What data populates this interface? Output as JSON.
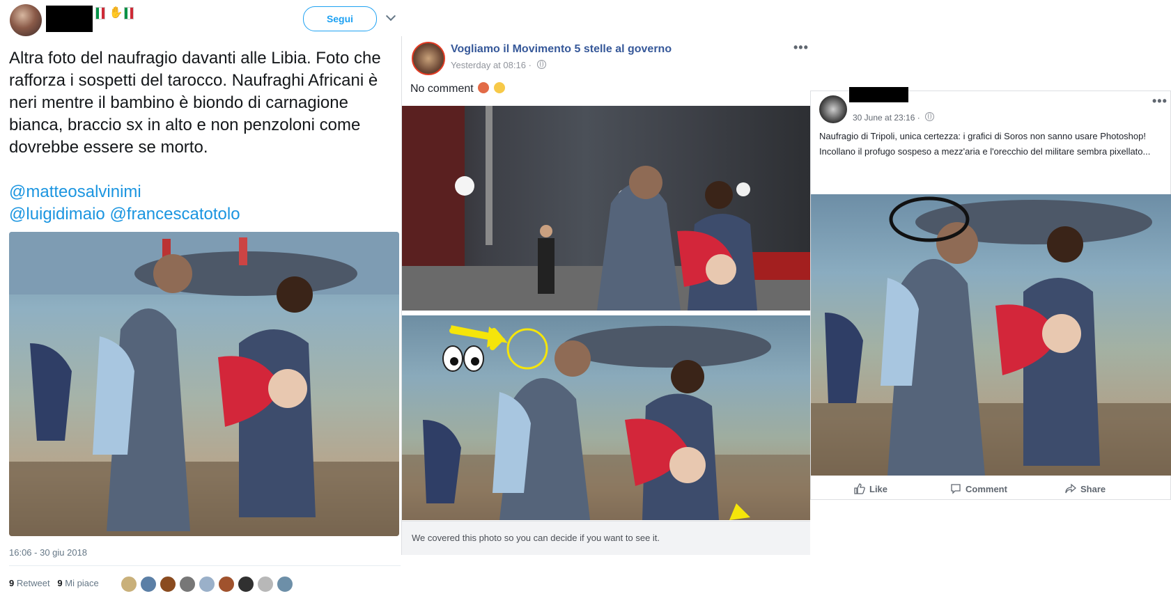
{
  "twitter": {
    "follow_label": "Segui",
    "tweet_text": "Altra foto del naufragio davanti alle Libia. Foto che rafforza i sospetti del tarocco. Naufraghi Africani è neri mentre il bambino è biondo di carnagione bianca, braccio sx in alto e non penzoloni come dovrebbe essere se morto.",
    "mention_1": "@matteosalvinimi",
    "mention_2": "@luigidimaio",
    "mention_3": "@francescatotolo",
    "timestamp": "16:06 - 30 giu 2018",
    "retweet_count": "9",
    "retweet_label": "Retweet",
    "like_count": "9",
    "like_label": "Mi piace",
    "liker_colors": [
      "#c9b07a",
      "#5b7fa6",
      "#8a4b1f",
      "#777777",
      "#9ab0c9",
      "#a0522d",
      "#303030",
      "#b8b8b8",
      "#6d8fa8"
    ]
  },
  "fb_post_1": {
    "page_name": "Vogliamo il Movimento 5 stelle al governo",
    "timestamp": "Yesterday at 08:16",
    "text": "No comment",
    "cover_notice": "We covered this photo so you can decide if you want to see it."
  },
  "fb_post_2": {
    "timestamp": "30 June at 23:16",
    "paragraph_1": "Naufragio di Tripoli, unica certezza: i grafici di Soros non sanno usare Photoshop!",
    "paragraph_2": "Incollano il profugo sospeso a mezz'aria e l'orecchio del militare sembra pixellato...",
    "like_label": "Like",
    "comment_label": "Comment",
    "share_label": "Share"
  },
  "colors": {
    "twitter_blue": "#1da1f2",
    "mention_blue": "#1b95e0",
    "facebook_link": "#365899"
  }
}
